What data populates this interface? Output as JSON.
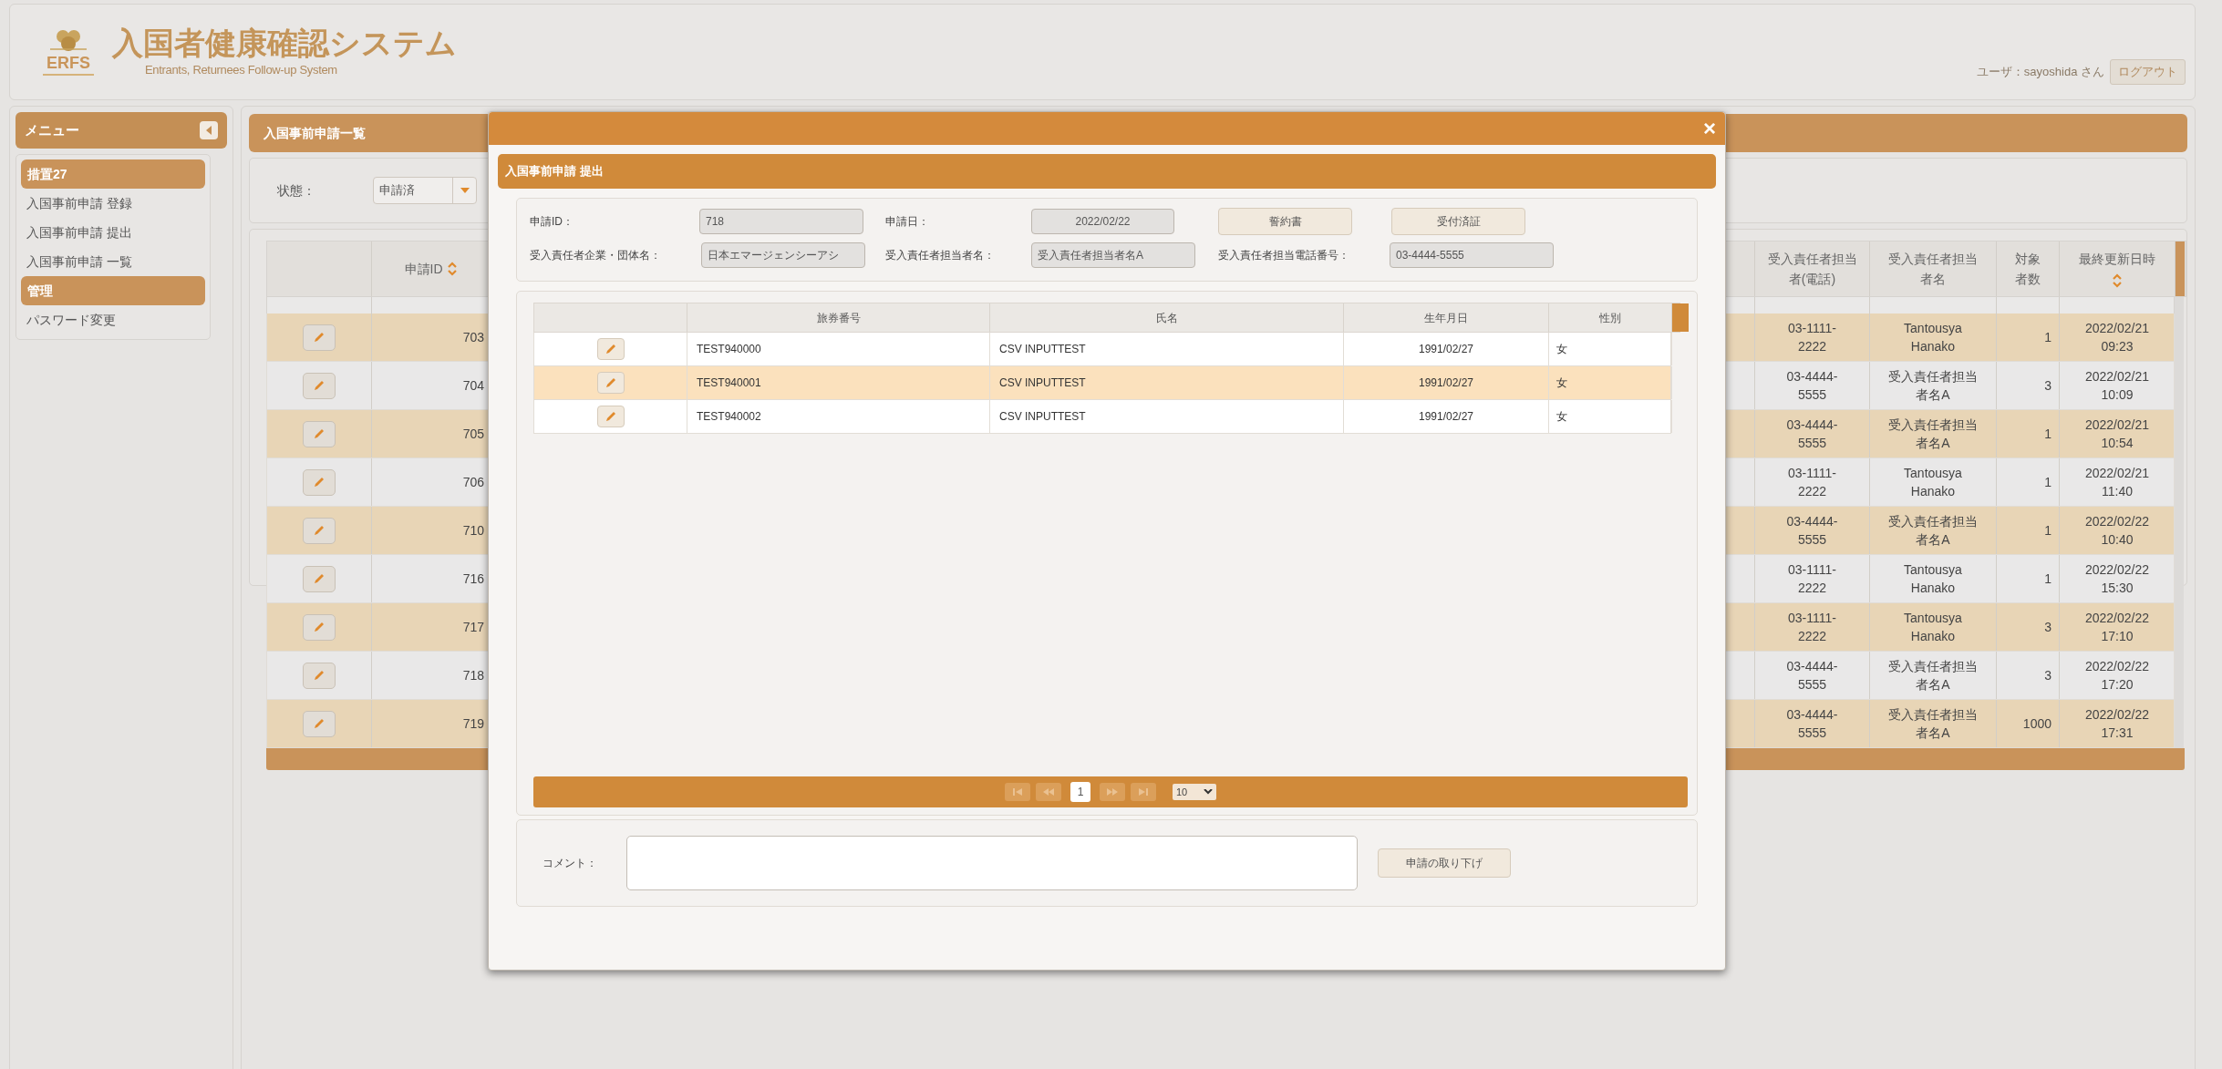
{
  "header": {
    "logo_text": "ERFS",
    "title": "入国者健康確認システム",
    "subtitle": "Entrants, Returnees Follow-up System",
    "user": "ユーザ：sayoshida さん",
    "logout": "ログアウト"
  },
  "sidebar": {
    "title": "メニュー",
    "groups": [
      {
        "title": "措置27",
        "items": [
          "入国事前申請 登録",
          "入国事前申請 提出",
          "入国事前申請 一覧"
        ]
      },
      {
        "title": "管理",
        "items": [
          "パスワード変更"
        ]
      }
    ]
  },
  "main": {
    "title": "入国事前申請一覧",
    "filter": {
      "label": "状態：",
      "value": "申請済"
    },
    "table": {
      "columns": [
        {
          "label": "申請ID",
          "sortable": true
        },
        {
          "label": "受入責任者担当者(電話)",
          "sortable": false
        },
        {
          "label": "受入責任者担当者名",
          "sortable": false
        },
        {
          "label": "対象者数",
          "sortable": false
        },
        {
          "label": "最終更新日時",
          "sortable": true
        }
      ],
      "rows": [
        {
          "id": "703",
          "phone": "03-1111-2222",
          "person": "Tantousya Hanako",
          "count": "1",
          "updated": "2022/02/21 09:23"
        },
        {
          "id": "704",
          "phone": "03-4444-5555",
          "person": "受入責任者担当者名A",
          "count": "3",
          "updated": "2022/02/21 10:09"
        },
        {
          "id": "705",
          "phone": "03-4444-5555",
          "person": "受入責任者担当者名A",
          "count": "1",
          "updated": "2022/02/21 10:54"
        },
        {
          "id": "706",
          "phone": "03-1111-2222",
          "person": "Tantousya Hanako",
          "count": "1",
          "updated": "2022/02/21 11:40"
        },
        {
          "id": "710",
          "phone": "03-4444-5555",
          "person": "受入責任者担当者名A",
          "count": "1",
          "updated": "2022/02/22 10:40"
        },
        {
          "id": "716",
          "phone": "03-1111-2222",
          "person": "Tantousya Hanako",
          "count": "1",
          "updated": "2022/02/22 15:30"
        },
        {
          "id": "717",
          "phone": "03-1111-2222",
          "person": "Tantousya Hanako",
          "count": "3",
          "updated": "2022/02/22 17:10"
        },
        {
          "id": "718",
          "phone": "03-4444-5555",
          "person": "受入責任者担当者名A",
          "count": "3",
          "updated": "2022/02/22 17:20"
        },
        {
          "id": "719",
          "phone": "03-4444-5555",
          "person": "受入責任者担当者名A",
          "count": "1000",
          "updated": "2022/02/22 17:31"
        }
      ]
    }
  },
  "modal": {
    "close": "×",
    "title": "入国事前申請 提出",
    "application_id": {
      "label": "申請ID：",
      "value": "718"
    },
    "application_date": {
      "label": "申請日：",
      "value": "2022/02/22"
    },
    "buttons": [
      "誓約書",
      "受付済証"
    ],
    "company": {
      "label": "受入責任者企業・団体名：",
      "value": "日本エマージェンシーアシ"
    },
    "person": {
      "label": "受入責任者担当者名：",
      "value": "受入責任者担当者名A"
    },
    "phone": {
      "label": "受入責任者担当電話番号：",
      "value": "03-4444-5555"
    },
    "grid": {
      "columns": [
        "旅券番号",
        "氏名",
        "生年月日",
        "性別"
      ],
      "rows": [
        {
          "passport": "TEST940000",
          "name": "CSV INPUTTEST",
          "birth": "1991/02/27",
          "sex": "女",
          "selected": false
        },
        {
          "passport": "TEST940001",
          "name": "CSV INPUTTEST",
          "birth": "1991/02/27",
          "sex": "女",
          "selected": true
        },
        {
          "passport": "TEST940002",
          "name": "CSV INPUTTEST",
          "birth": "1991/02/27",
          "sex": "女",
          "selected": false
        }
      ]
    },
    "pager": {
      "page": "1",
      "page_size": "10"
    },
    "comment": {
      "label": "コメント："
    },
    "withdraw_button": "申請の取り下げ"
  }
}
